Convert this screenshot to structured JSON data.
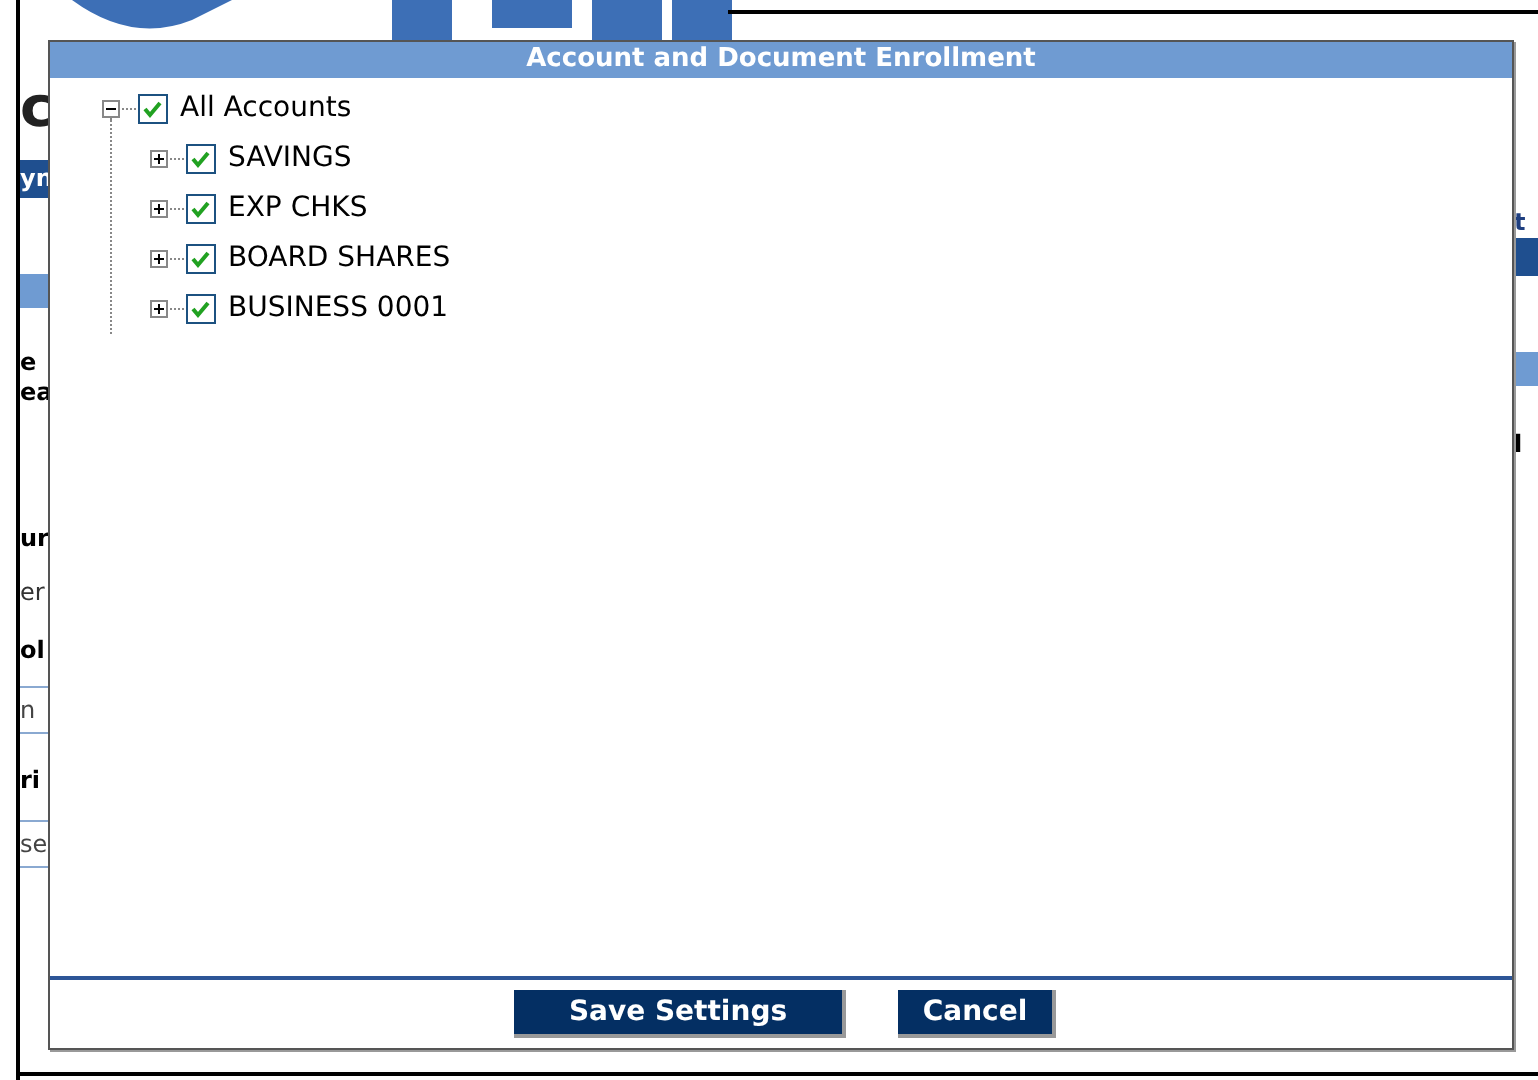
{
  "background": {
    "left": [
      {
        "kind": "heading",
        "text": "c"
      },
      {
        "kind": "nav_bar",
        "text": "yn"
      },
      {
        "kind": "section_bar"
      },
      {
        "kind": "label",
        "text": "e"
      },
      {
        "kind": "label",
        "text": "ea"
      },
      {
        "kind": "label",
        "text": "ur"
      },
      {
        "kind": "text",
        "text": "er"
      },
      {
        "kind": "label",
        "text": "ol"
      },
      {
        "kind": "field",
        "text": "n"
      },
      {
        "kind": "label",
        "text": "ri"
      },
      {
        "kind": "field",
        "text": "se"
      }
    ],
    "right": [
      {
        "kind": "link",
        "text": "t"
      },
      {
        "kind": "nav_bar"
      },
      {
        "kind": "section_bar"
      },
      {
        "kind": "label",
        "text": "l"
      }
    ]
  },
  "dialog": {
    "title": "Account and Document Enrollment",
    "tree": {
      "label": "All Accounts",
      "checked": true,
      "expanded": true,
      "children": [
        {
          "label": "SAVINGS",
          "checked": true,
          "expanded": false
        },
        {
          "label": "EXP CHKS",
          "checked": true,
          "expanded": false
        },
        {
          "label": "BOARD SHARES",
          "checked": true,
          "expanded": false
        },
        {
          "label": "BUSINESS 0001",
          "checked": true,
          "expanded": false
        }
      ]
    },
    "buttons": [
      "Save Settings",
      "Cancel"
    ]
  }
}
